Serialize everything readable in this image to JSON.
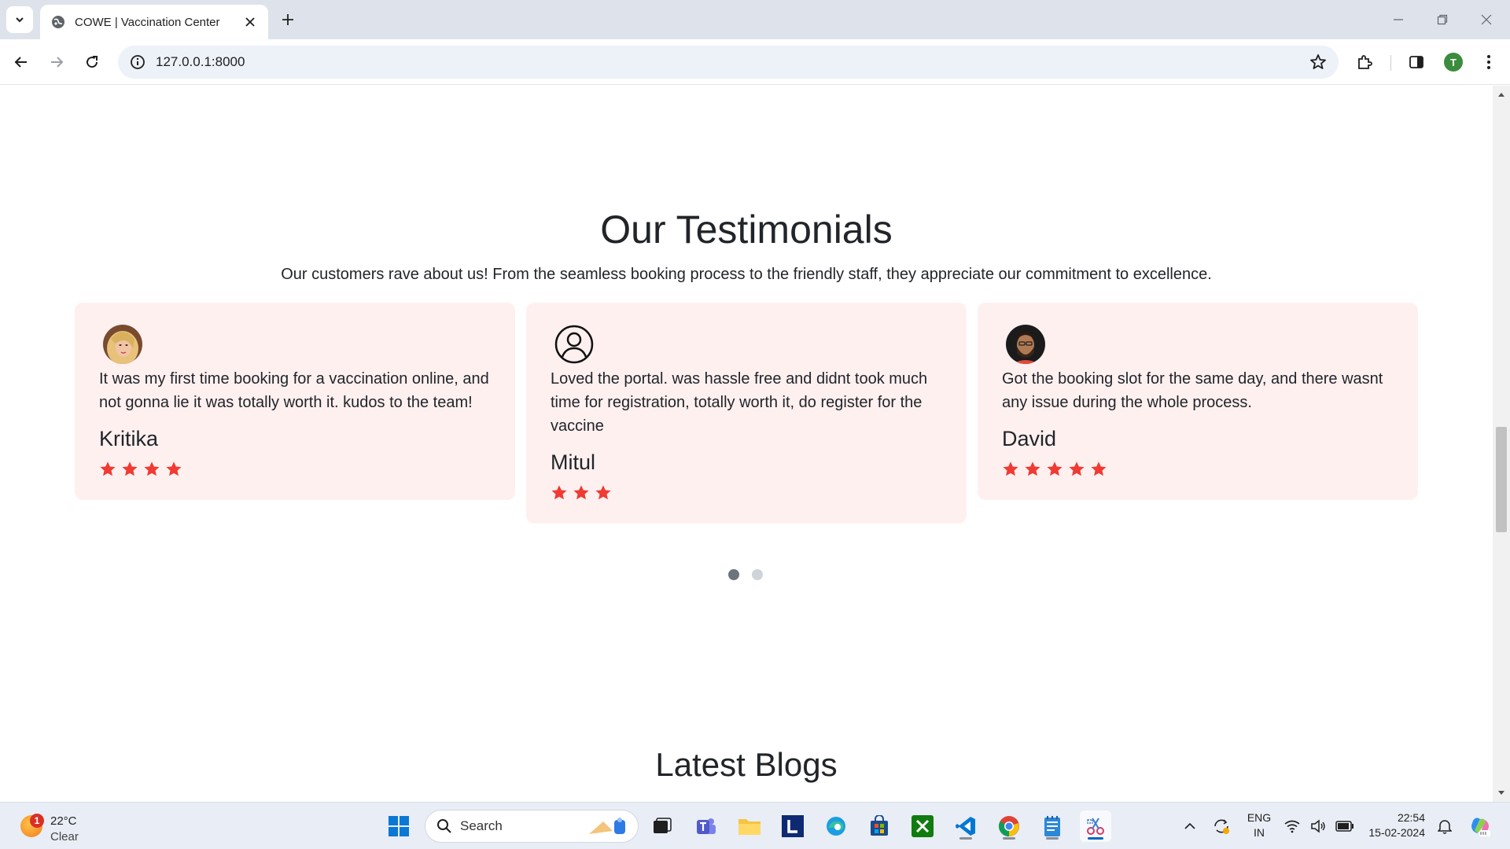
{
  "browser": {
    "tab_title": "COWE | Vaccination Center",
    "url": "127.0.0.1:8000",
    "profile_initial": "T"
  },
  "testimonials": {
    "title": "Our Testimonials",
    "subtitle": "Our customers rave about us! From the seamless booking process to the friendly staff, they appreciate our commitment to excellence.",
    "cards": [
      {
        "text": "It was my first time booking for a vaccination online, and not gonna lie it was totally worth it. kudos to the team!",
        "name": "Kritika",
        "rating": 4,
        "avatar": "female-photo"
      },
      {
        "text": "Loved the portal. was hassle free and didnt took much time for registration, totally worth it, do register for the vaccine",
        "name": "Mitul",
        "rating": 3,
        "avatar": "user-outline-icon"
      },
      {
        "text": "Got the booking slot for the same day, and there wasnt any issue during the whole process.",
        "name": "David",
        "rating": 5,
        "avatar": "male-photo"
      }
    ],
    "carousel": {
      "pages": 2,
      "active": 1
    }
  },
  "blogs": {
    "title": "Latest Blogs"
  },
  "colors": {
    "card_bg": "#fff0f0",
    "star": "#f03a32",
    "call_button": "#f03a32",
    "dot_active": "#6c757d",
    "dot_inactive": "#ced4da"
  },
  "taskbar": {
    "weather_badge": "1",
    "temperature": "22°C",
    "condition": "Clear",
    "search_label": "Search",
    "lang_line1": "ENG",
    "lang_line2": "IN",
    "time": "22:54",
    "date": "15-02-2024"
  }
}
